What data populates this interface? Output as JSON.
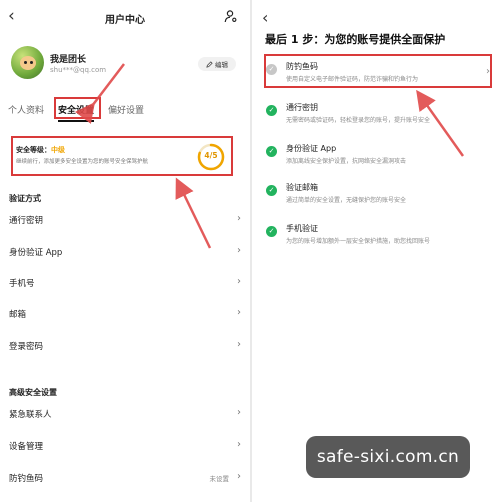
{
  "left": {
    "title": "用户中心",
    "user": {
      "name": "我是团长",
      "email": "shu***@qq.com"
    },
    "edit_label": "编辑",
    "tabs": [
      "个人资料",
      "安全设置",
      "偏好设置"
    ],
    "security": {
      "label": "安全等级：",
      "level": "中级",
      "desc": "继续前行，添加更多安全设置为您的账号安全保驾护航",
      "score": "4/5",
      "score_fraction": 0.8
    },
    "verify_section": "验证方式",
    "verify_items": [
      {
        "label": "通行密钥"
      },
      {
        "label": "身份验证 App"
      },
      {
        "label": "手机号"
      },
      {
        "label": "邮箱"
      },
      {
        "label": "登录密码"
      }
    ],
    "advanced_section": "高级安全设置",
    "advanced_items": [
      {
        "label": "紧急联系人",
        "value": ""
      },
      {
        "label": "设备管理",
        "value": ""
      },
      {
        "label": "防钓鱼码",
        "value": "未设置"
      }
    ]
  },
  "right": {
    "title": "最后 1 步：为您的账号提供全面保护",
    "options": [
      {
        "name": "防钓鱼码",
        "desc": "使用自定义电子邮件验证码，防范诈骗和钓鱼行为",
        "status": "pending"
      },
      {
        "name": "通行密钥",
        "desc": "无需密码或验证码，轻松登录您的账号，提升账号安全",
        "status": "done"
      },
      {
        "name": "身份验证 App",
        "desc": "添加离线安全保护设置，抗网络安全漏洞攻击",
        "status": "done"
      },
      {
        "name": "验证邮箱",
        "desc": "通过简单的安全设置，无缝保护您的账号安全",
        "status": "done"
      },
      {
        "name": "手机验证",
        "desc": "为您的账号增加额外一层安全保护措施，助您找回账号",
        "status": "done"
      }
    ]
  },
  "watermark": "safe-sixi.com.cn",
  "colors": {
    "highlight": "#d93a3a",
    "accent": "#f0a500",
    "check": "#22b35e"
  },
  "icons": {
    "back": "chevron-left-icon",
    "user_settings": "user-gear-icon",
    "edit": "pencil-icon",
    "check": "check-circle-icon"
  }
}
